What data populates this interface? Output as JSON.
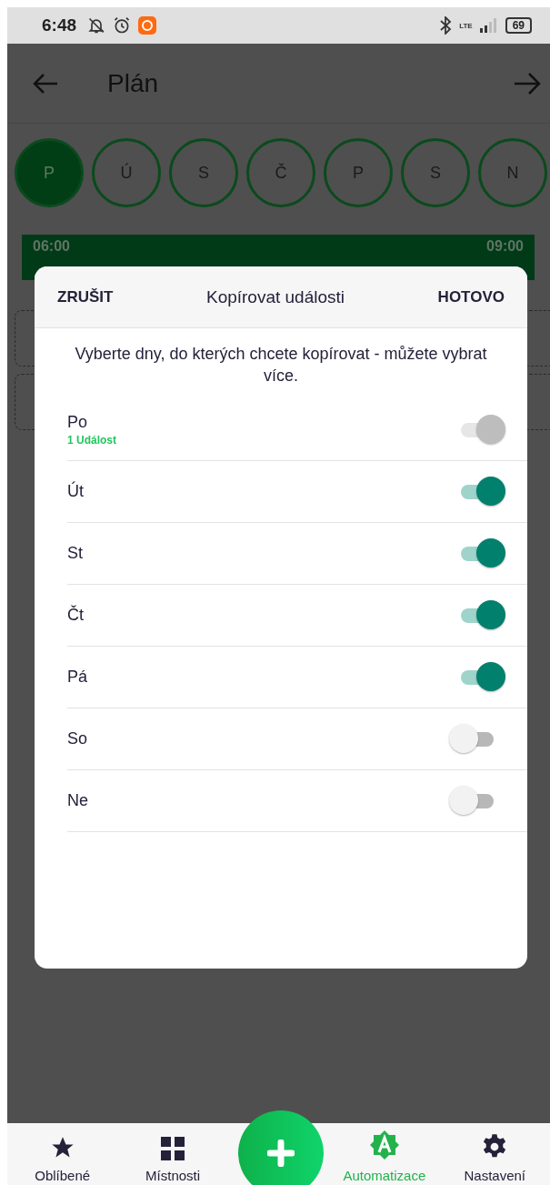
{
  "status_bar": {
    "time": "6:48",
    "network": "LTE",
    "battery": "69"
  },
  "app_bar": {
    "title": "Plán"
  },
  "days": [
    {
      "label": "P",
      "selected": true
    },
    {
      "label": "Ú",
      "selected": false
    },
    {
      "label": "S",
      "selected": false
    },
    {
      "label": "Č",
      "selected": false
    },
    {
      "label": "P",
      "selected": false
    },
    {
      "label": "S",
      "selected": false
    },
    {
      "label": "N",
      "selected": false
    }
  ],
  "event": {
    "start": "06:00",
    "end": "09:00"
  },
  "dialog": {
    "cancel": "ZRUŠIT",
    "title": "Kopírovat události",
    "done": "HOTOVO",
    "description": "Vyberte dny, do kterých chcete kopírovat - můžete vybrat více.",
    "days": [
      {
        "label": "Po",
        "note": "1 Událost",
        "on": true,
        "disabled": true
      },
      {
        "label": "Út",
        "on": true,
        "disabled": false
      },
      {
        "label": "St",
        "on": true,
        "disabled": false
      },
      {
        "label": "Čt",
        "on": true,
        "disabled": false
      },
      {
        "label": "Pá",
        "on": true,
        "disabled": false
      },
      {
        "label": "So",
        "on": false,
        "disabled": false
      },
      {
        "label": "Ne",
        "on": false,
        "disabled": false
      }
    ]
  },
  "nav": [
    {
      "label": "Oblíbené",
      "kind": "star",
      "selected": false
    },
    {
      "label": "Místnosti",
      "kind": "grid",
      "selected": false
    },
    {
      "label": "Automatizace",
      "kind": "auto",
      "selected": true
    },
    {
      "label": "Nastavení",
      "kind": "gear",
      "selected": false
    }
  ]
}
